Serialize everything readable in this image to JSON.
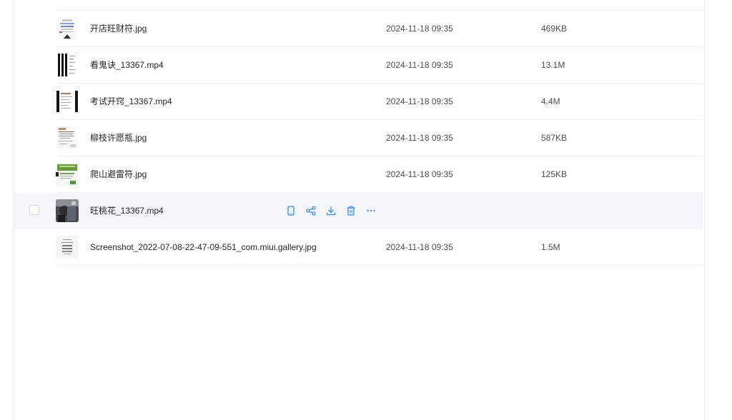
{
  "colors": {
    "accent": "#2f8df5",
    "hover_row": "#f4f6fa"
  },
  "files": [
    {
      "name": "开店旺财符.jpg",
      "time": "2024-11-18 09:35",
      "size": "469KB",
      "thumb": "doc-image-thumb"
    },
    {
      "name": "看鬼诀_13367.mp4",
      "time": "2024-11-18 09:35",
      "size": "13.1M",
      "thumb": "video-thumb"
    },
    {
      "name": "考试开窍_13367.mp4",
      "time": "2024-11-18 09:35",
      "size": "4.4M",
      "thumb": "video-thumb"
    },
    {
      "name": "柳枝许愿瓶.jpg",
      "time": "2024-11-18 09:35",
      "size": "587KB",
      "thumb": "doc-image-thumb"
    },
    {
      "name": "爬山避雷符.jpg",
      "time": "2024-11-18 09:35",
      "size": "125KB",
      "thumb": "green-image-thumb"
    },
    {
      "name": "旺桃花_13367.mp4",
      "time": "",
      "size": "",
      "thumb": "photo-thumb",
      "hovered": true
    },
    {
      "name": "Screenshot_2022-07-08-22-47-09-551_com.miui.gallery.jpg",
      "time": "2024-11-18 09:35",
      "size": "1.5M",
      "thumb": "screenshot-thumb"
    }
  ],
  "row_actions": [
    "open-on-phone-icon",
    "share-icon",
    "download-icon",
    "delete-icon",
    "more-icon"
  ]
}
